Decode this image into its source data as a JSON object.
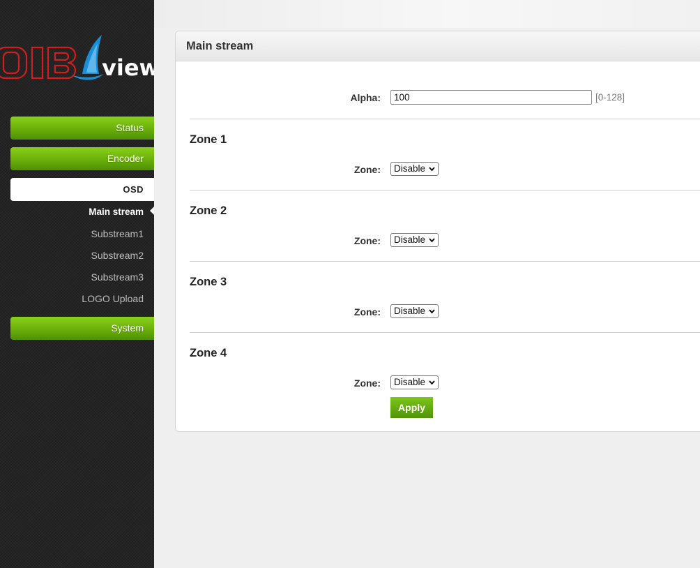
{
  "logo": {
    "text_left": "DIB",
    "text_right": "view"
  },
  "colors": {
    "accent_green": "#6fb50c",
    "logo_red": "#d11f1f",
    "logo_blue": "#1a8fd8"
  },
  "nav": {
    "status": "Status",
    "encoder": "Encoder",
    "osd": "OSD",
    "system": "System",
    "osd_items": [
      "Main stream",
      "Substream1",
      "Substream2",
      "Substream3",
      "LOGO Upload"
    ]
  },
  "panel": {
    "title": "Main stream",
    "alpha": {
      "label": "Alpha:",
      "value": "100",
      "range": "[0-128]"
    },
    "zones": [
      {
        "title": "Zone 1",
        "label": "Zone:",
        "value": "Disable"
      },
      {
        "title": "Zone 2",
        "label": "Zone:",
        "value": "Disable"
      },
      {
        "title": "Zone 3",
        "label": "Zone:",
        "value": "Disable"
      },
      {
        "title": "Zone 4",
        "label": "Zone:",
        "value": "Disable"
      }
    ],
    "apply": "Apply"
  }
}
